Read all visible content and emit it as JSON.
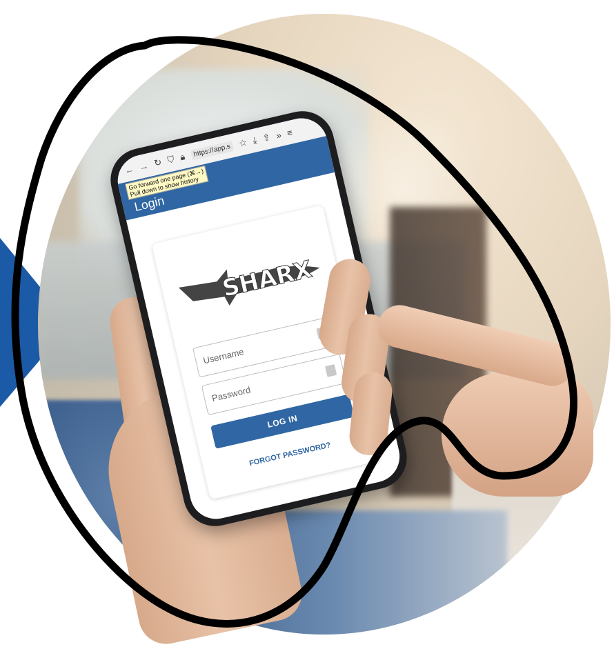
{
  "browser": {
    "nav_icons": [
      "back-arrow-icon",
      "forward-arrow-icon",
      "reload-icon",
      "shield-icon",
      "lock-icon"
    ],
    "url": "https://app.s",
    "toolbar_icons": [
      "star-icon",
      "download-icon",
      "share-icon",
      "overflow-chevrons-icon",
      "menu-icon"
    ],
    "tooltip_line1": "Go forward one page (⌘→)",
    "tooltip_line2": "Pull down to show history"
  },
  "app": {
    "title": "Login",
    "logo_text": "SHARX",
    "username_placeholder": "Username",
    "password_placeholder": "Password",
    "login_button": "LOG IN",
    "forgot_link": "FORGOT PASSWORD?"
  },
  "colors": {
    "brand_blue": "#2f66a3",
    "arrow_blue": "#1a5aa6",
    "outline_black": "#000000"
  }
}
